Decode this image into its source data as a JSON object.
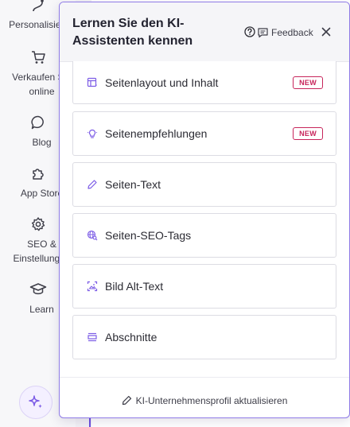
{
  "sidebar": {
    "items": [
      {
        "label": "Personalisieren",
        "icon": "route-icon"
      },
      {
        "label": "Verkaufen Sie online",
        "icon": "cart-icon"
      },
      {
        "label": "Blog",
        "icon": "chat-bubble-icon"
      },
      {
        "label": "App Store",
        "icon": "puzzle-icon"
      },
      {
        "label": "SEO & Einstellungen",
        "icon": "gear-icon"
      },
      {
        "label": "Learn",
        "icon": "graduation-cap-icon"
      }
    ],
    "ai_button_icon": "sparkles-icon"
  },
  "panel": {
    "title": "Lernen Sie den KI-Assistenten kennen",
    "feedback_label": "Feedback",
    "items": [
      {
        "label": "Seitenlayout und Inhalt",
        "badge": "NEW",
        "icon": "layout-icon"
      },
      {
        "label": "Seitenempfehlungen",
        "badge": "NEW",
        "icon": "lightbulb-icon"
      },
      {
        "label": "Seiten-Text",
        "icon": "pencil-icon"
      },
      {
        "label": "Seiten-SEO-Tags",
        "icon": "globe-search-icon"
      },
      {
        "label": "Bild Alt-Text",
        "icon": "image-scan-icon"
      },
      {
        "label": "Abschnitte",
        "icon": "sections-icon"
      }
    ],
    "footer_link": "KI-Unternehmensprofil aktualisieren"
  },
  "colors": {
    "accent": "#8f7be6",
    "badge": "#c7255b",
    "icon_purple": "#7c5ce6"
  }
}
